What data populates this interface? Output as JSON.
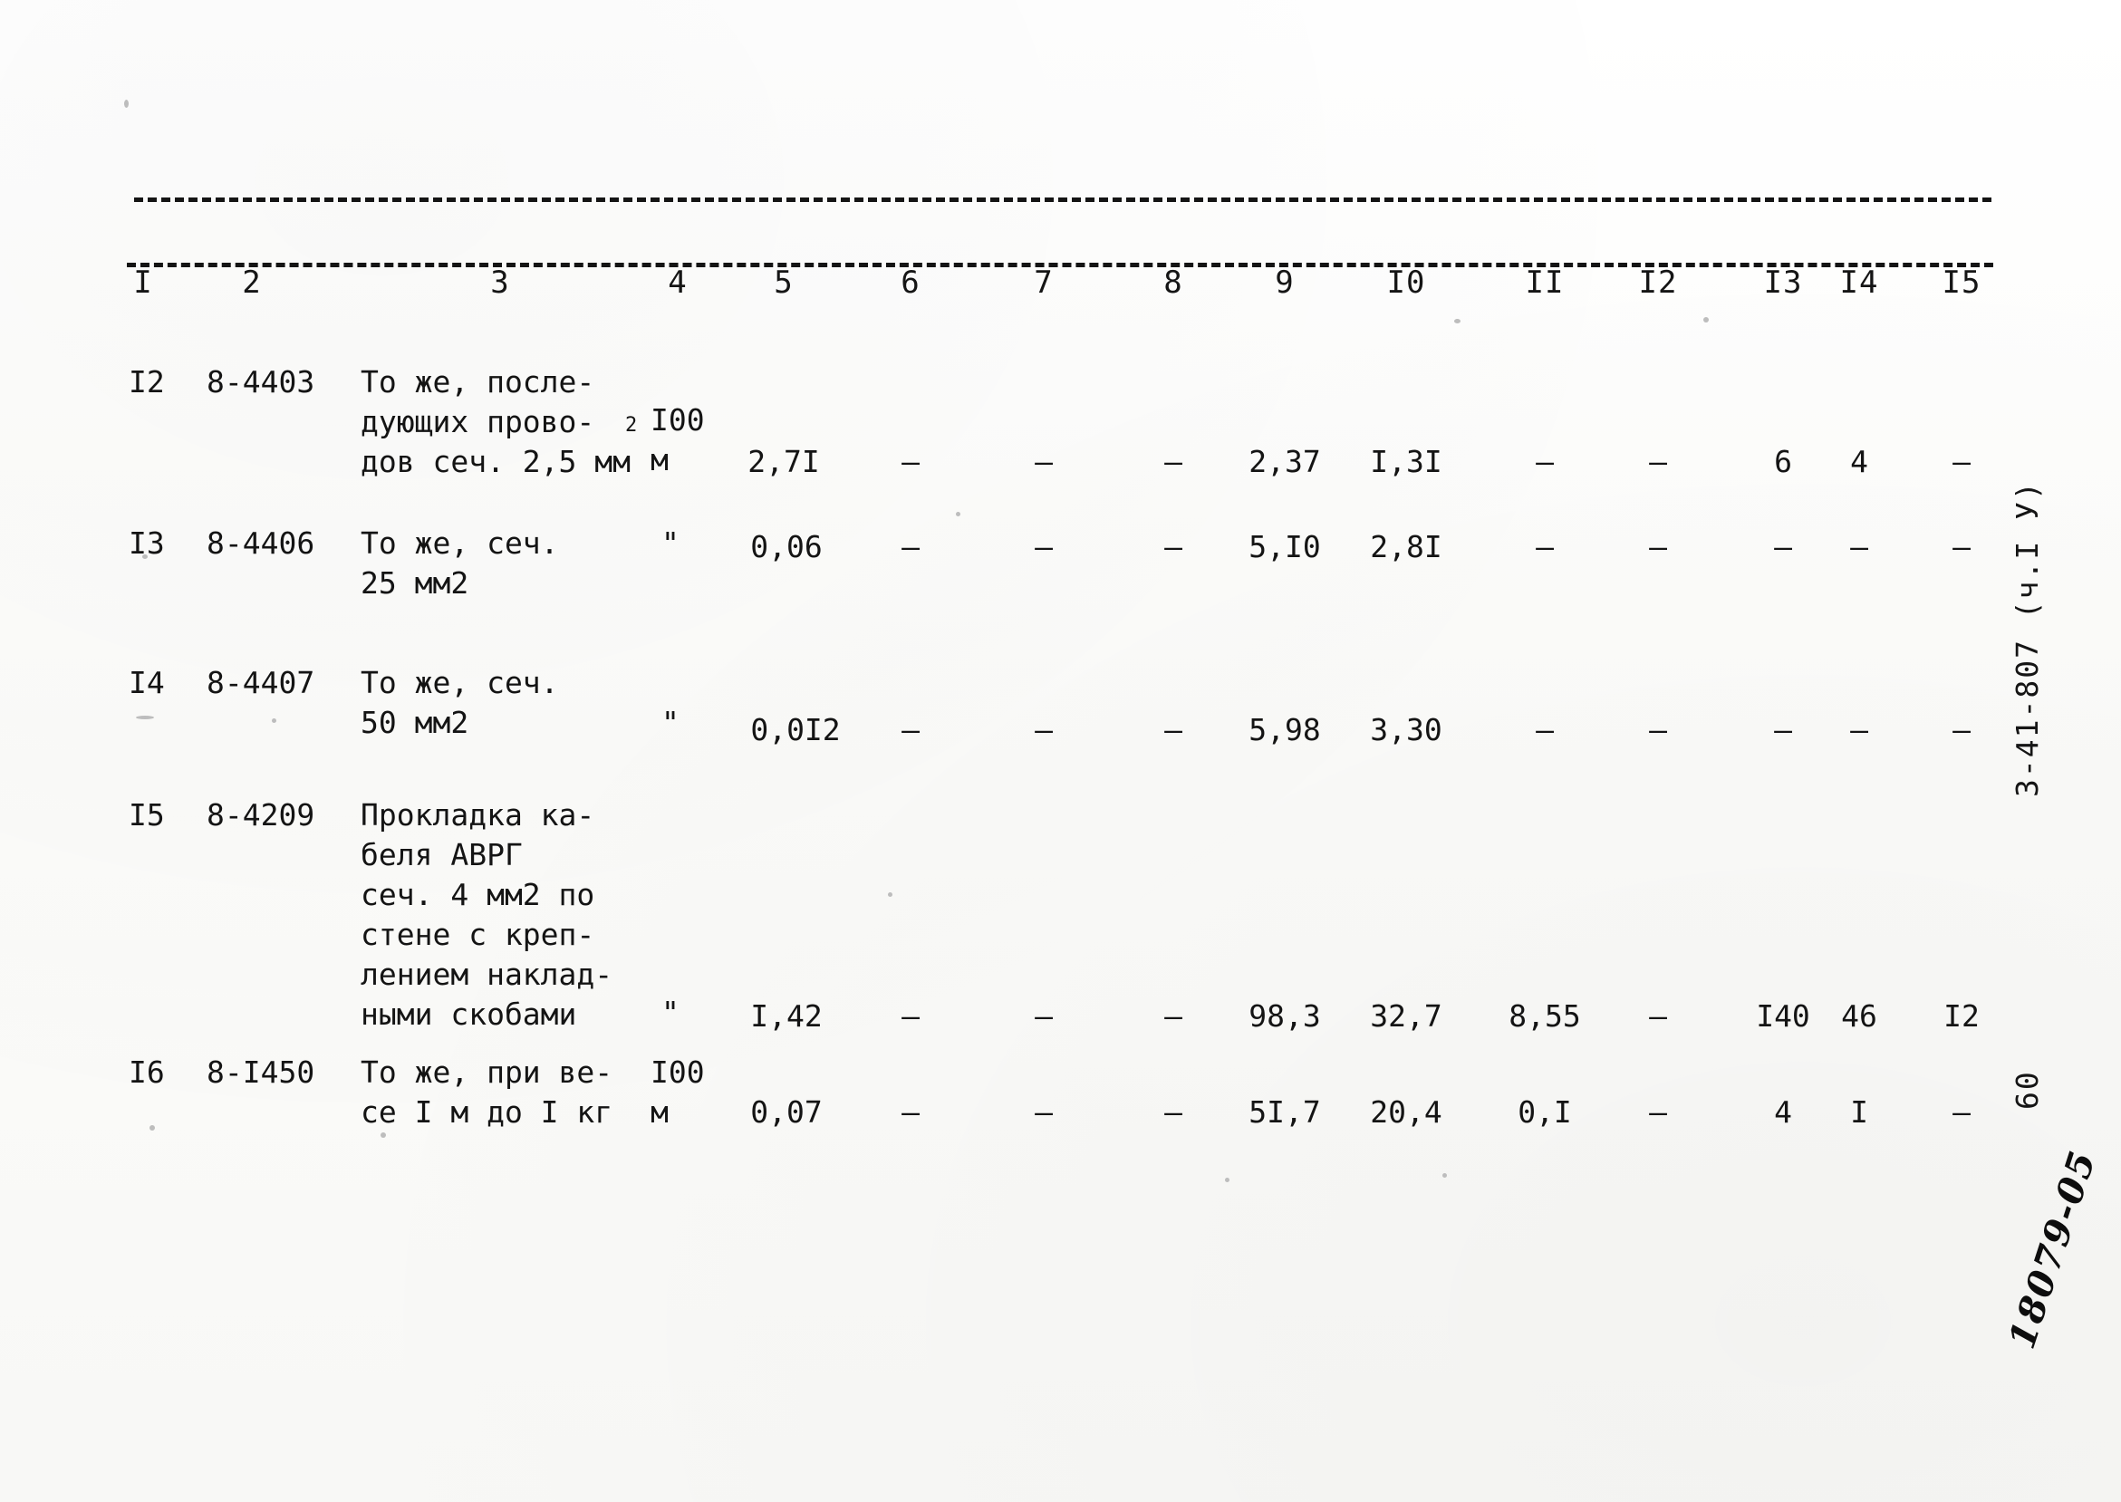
{
  "document": {
    "margin_code": "3-41-807 (ч.I У)",
    "margin_page_number": "60",
    "handwritten_stamp": "18079-05"
  },
  "table": {
    "column_headers": [
      "I",
      "2",
      "3",
      "4",
      "5",
      "6",
      "7",
      "8",
      "9",
      "I0",
      "II",
      "I2",
      "I3",
      "I4",
      "I5"
    ],
    "rows": [
      {
        "num": "I2",
        "code": "8-4403",
        "description": "То же, после-\nдующих прово-\nдов сеч. 2,5 мм",
        "description_superscript": "2",
        "unit": "I00\nм",
        "c5": "2,7I",
        "c6": "–",
        "c7": "–",
        "c8": "–",
        "c9": "2,37",
        "c10": "I,3I",
        "c11": "–",
        "c12": "–",
        "c13": "6",
        "c14": "4",
        "c15": "–"
      },
      {
        "num": "I3",
        "code": "8-4406",
        "description": "То же, сеч.\n25 мм2",
        "description_superscript": "",
        "unit": "\"",
        "c5": "0,06",
        "c6": "–",
        "c7": "–",
        "c8": "–",
        "c9": "5,I0",
        "c10": "2,8I",
        "c11": "–",
        "c12": "–",
        "c13": "–",
        "c14": "–",
        "c15": "–"
      },
      {
        "num": "I4",
        "code": "8-4407",
        "description": "То же, сеч.\n50 мм2",
        "description_superscript": "",
        "unit": "\"",
        "c5": "0,0I2",
        "c6": "–",
        "c7": "–",
        "c8": "–",
        "c9": "5,98",
        "c10": "3,30",
        "c11": "–",
        "c12": "–",
        "c13": "–",
        "c14": "–",
        "c15": "–"
      },
      {
        "num": "I5",
        "code": "8-4209",
        "description": "Прокладка ка-\nбеля АВРГ\nсеч. 4 мм2 по\nстене с креп-\nлением наклад-\nными скобами",
        "description_superscript": "",
        "unit": "\"",
        "c5": "I,42",
        "c6": "–",
        "c7": "–",
        "c8": "–",
        "c9": "98,3",
        "c10": "32,7",
        "c11": "8,55",
        "c12": "–",
        "c13": "I40",
        "c14": "46",
        "c15": "I2"
      },
      {
        "num": "I6",
        "code": "8-I450",
        "description": "То же, при ве-\nсе I м до I кг",
        "description_superscript": "",
        "unit": "I00\nм",
        "c5": "0,07",
        "c6": "–",
        "c7": "–",
        "c8": "–",
        "c9": "5I,7",
        "c10": "20,4",
        "c11": "0,I",
        "c12": "–",
        "c13": "4",
        "c14": "I",
        "c15": "–"
      }
    ]
  }
}
